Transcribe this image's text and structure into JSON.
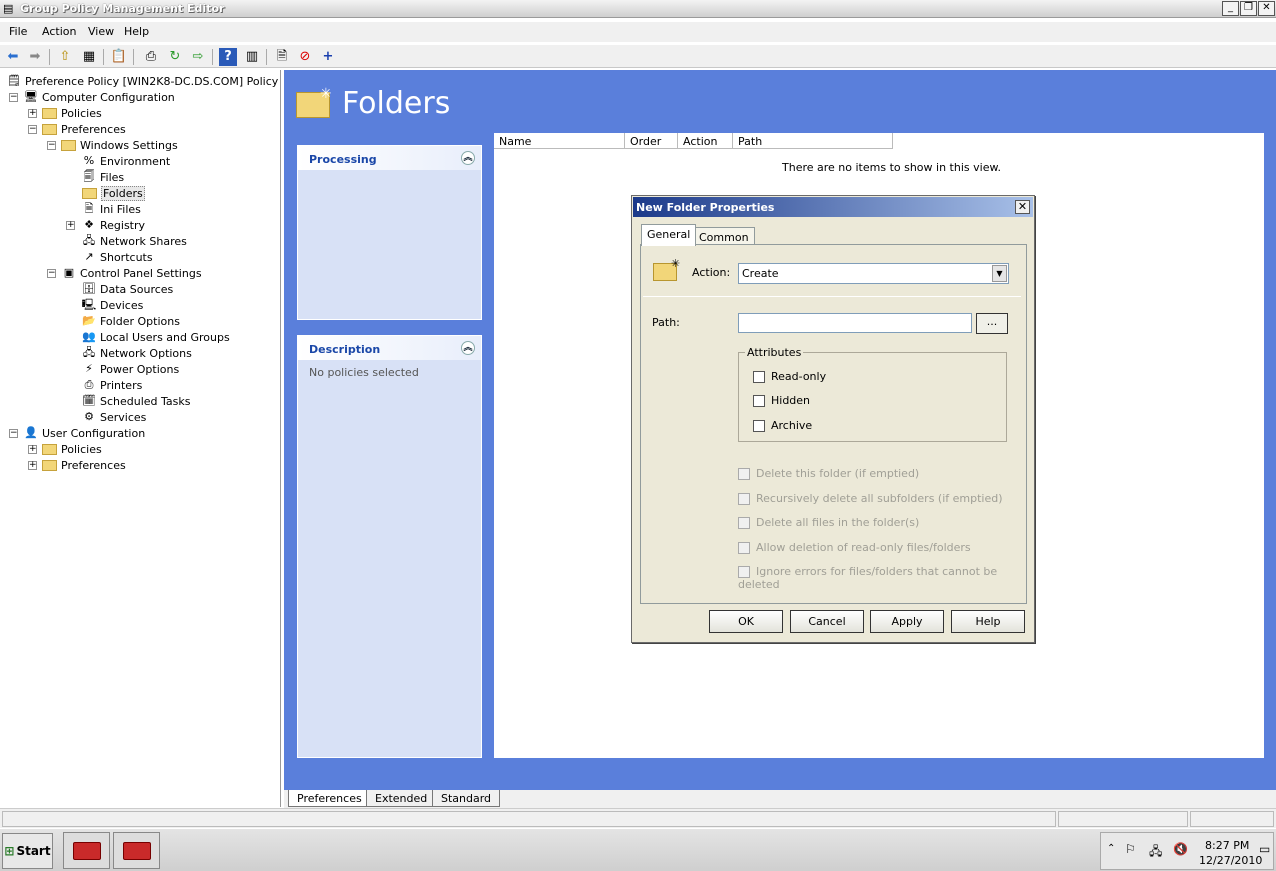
{
  "window": {
    "title": "Group Policy Management Editor"
  },
  "menu": [
    "File",
    "Action",
    "View",
    "Help"
  ],
  "tree": {
    "root": "Preference Policy [WIN2K8-DC.DS.COM] Policy",
    "computer_config": "Computer Configuration",
    "policies": "Policies",
    "preferences": "Preferences",
    "windows_settings": "Windows Settings",
    "ws_items": [
      "Environment",
      "Files",
      "Folders",
      "Ini Files",
      "Registry",
      "Network Shares",
      "Shortcuts"
    ],
    "control_panel": "Control Panel Settings",
    "cp_items": [
      "Data Sources",
      "Devices",
      "Folder Options",
      "Local Users and Groups",
      "Network Options",
      "Power Options",
      "Printers",
      "Scheduled Tasks",
      "Services"
    ],
    "user_config": "User Configuration",
    "user_policies": "Policies",
    "user_preferences": "Preferences"
  },
  "main": {
    "title": "Folders",
    "processing_title": "Processing",
    "description_title": "Description",
    "description_text": "No policies selected",
    "columns": [
      "Name",
      "Order",
      "Action",
      "Path"
    ],
    "empty_text": "There are no items to show in this view."
  },
  "bottom_tabs": [
    "Preferences",
    "Extended",
    "Standard"
  ],
  "dialog": {
    "title": "New Folder Properties",
    "tabs": [
      "General",
      "Common"
    ],
    "action_label": "Action:",
    "action_value": "Create",
    "path_label": "Path:",
    "path_value": "",
    "browse": "...",
    "attributes_title": "Attributes",
    "attributes": [
      "Read-only",
      "Hidden",
      "Archive"
    ],
    "options": [
      "Delete this folder (if emptied)",
      "Recursively delete all subfolders (if emptied)",
      "Delete all files in the folder(s)",
      "Allow deletion of read-only files/folders",
      "Ignore errors for files/folders that cannot be deleted"
    ],
    "buttons": [
      "OK",
      "Cancel",
      "Apply",
      "Help"
    ]
  },
  "taskbar": {
    "start": "Start",
    "time": "8:27 PM",
    "date": "12/27/2010"
  }
}
